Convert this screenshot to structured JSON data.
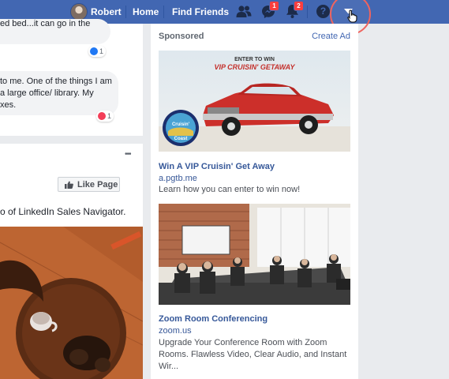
{
  "topbar": {
    "user_name": "Robert",
    "home": "Home",
    "find_friends": "Find Friends",
    "messages_badge": "1",
    "notifications_badge": "2",
    "help_symbol": "?",
    "bg_color": "#4267b2"
  },
  "feed": {
    "comment1_text": "ed bed...it can go in the",
    "comment1_reaction_count": "1",
    "comment2_lines": [
      "to me. One of the things I am",
      "a large office/ library. My",
      "xes."
    ],
    "comment2_reaction_count": "1",
    "post_more": "•••",
    "like_page_label": "Like Page",
    "post_text": "o of LinkedIn Sales Navigator."
  },
  "sponsored": {
    "heading": "Sponsored",
    "create_ad": "Create Ad",
    "ads": [
      {
        "image_caption_top": "ENTER TO WIN",
        "image_caption_main": "VIP CRUISIN' GETAWAY",
        "logo_text_1": "Cruisin'",
        "logo_text_2": "Coast",
        "title": "Win A VIP Cruisin' Get Away",
        "url": "a.pgtb.me",
        "description": "Learn how you can enter to win now!"
      },
      {
        "title": "Zoom Room Conferencing",
        "url": "zoom.us",
        "description_lines": [
          "Upgrade Your Conference Room with Zoom",
          "Rooms. Flawless Video, Clear Audio, and Instant",
          "Wir..."
        ]
      }
    ]
  }
}
